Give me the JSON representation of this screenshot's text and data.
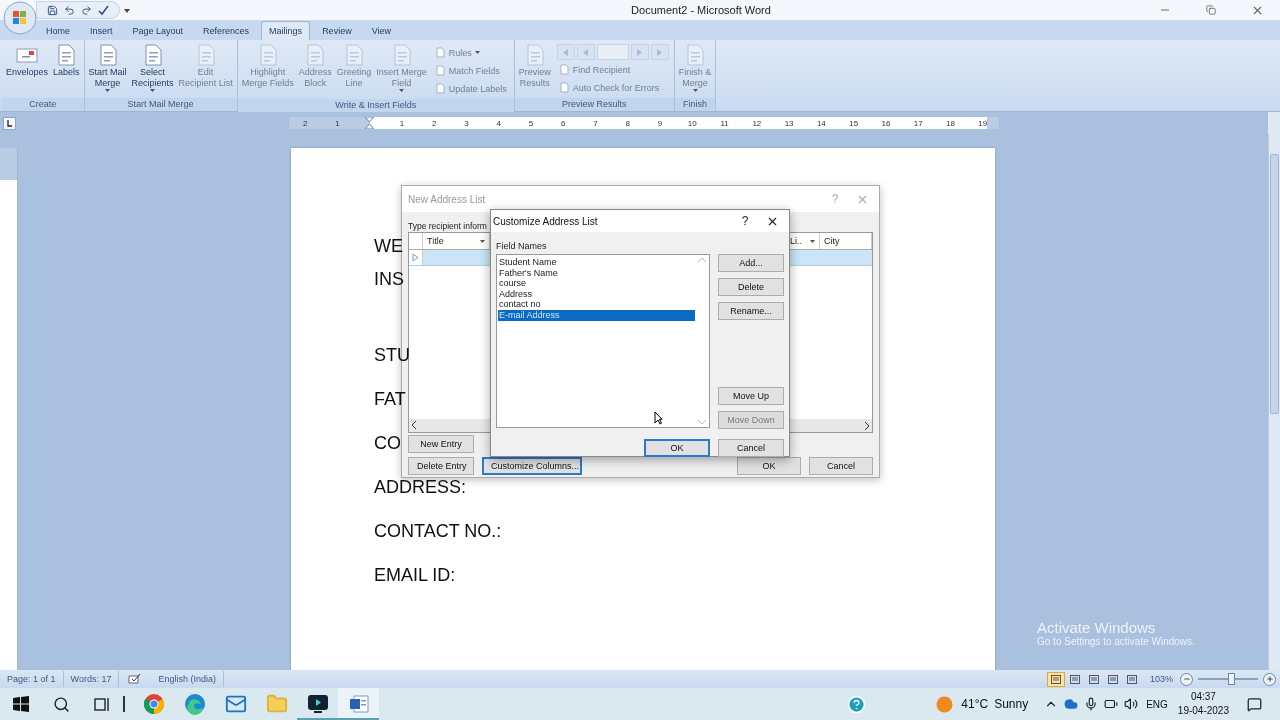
{
  "title_bar": {
    "title": "Document2 - Microsoft Word"
  },
  "tabs": [
    {
      "label": "Home",
      "selected": false
    },
    {
      "label": "Insert",
      "selected": false
    },
    {
      "label": "Page Layout",
      "selected": false
    },
    {
      "label": "References",
      "selected": false
    },
    {
      "label": "Mailings",
      "selected": true
    },
    {
      "label": "Review",
      "selected": false
    },
    {
      "label": "View",
      "selected": false
    }
  ],
  "ribbon_groups": [
    {
      "label": "Create",
      "items": [
        {
          "kind": "large",
          "label": "Envelopes",
          "dropdown": false,
          "disabled": false
        },
        {
          "kind": "large",
          "label": "Labels",
          "dropdown": false,
          "disabled": false
        }
      ]
    },
    {
      "label": "Start Mail Merge",
      "items": [
        {
          "kind": "large",
          "label": "Start Mail\nMerge",
          "dropdown": true,
          "disabled": false
        },
        {
          "kind": "large",
          "label": "Select\nRecipients",
          "dropdown": true,
          "disabled": false
        },
        {
          "kind": "large",
          "label": "Edit\nRecipient List",
          "dropdown": false,
          "disabled": true
        }
      ]
    },
    {
      "label": "Write & Insert Fields",
      "items": [
        {
          "kind": "large",
          "label": "Highlight\nMerge Fields",
          "dropdown": false,
          "disabled": true
        },
        {
          "kind": "large",
          "label": "Address\nBlock",
          "dropdown": false,
          "disabled": true
        },
        {
          "kind": "large",
          "label": "Greeting\nLine",
          "dropdown": false,
          "disabled": true
        },
        {
          "kind": "large",
          "label": "Insert Merge\nField",
          "dropdown": true,
          "disabled": true
        },
        {
          "kind": "small",
          "label": "Rules",
          "dropdown": true,
          "disabled": true
        },
        {
          "kind": "small",
          "label": "Match Fields",
          "dropdown": false,
          "disabled": true
        },
        {
          "kind": "small",
          "label": "Update Labels",
          "dropdown": false,
          "disabled": true
        }
      ]
    },
    {
      "label": "Preview Results",
      "items": [
        {
          "kind": "large",
          "label": "Preview\nResults",
          "dropdown": false,
          "disabled": true
        },
        {
          "kind": "nav",
          "disabled": true
        },
        {
          "kind": "small",
          "label": "Find Recipient",
          "dropdown": false,
          "disabled": true
        },
        {
          "kind": "small",
          "label": "Auto Check for Errors",
          "dropdown": false,
          "disabled": true
        }
      ]
    },
    {
      "label": "Finish",
      "items": [
        {
          "kind": "large",
          "label": "Finish &\nMerge",
          "dropdown": true,
          "disabled": true
        }
      ]
    }
  ],
  "ruler": {
    "marks": [
      "2",
      "1",
      "1",
      "2",
      "3",
      "4",
      "5",
      "6",
      "7",
      "8",
      "9",
      "10",
      "11",
      "12",
      "13",
      "14",
      "15",
      "16",
      "17",
      "18",
      "19"
    ]
  },
  "document": {
    "blocks": [
      [
        "WE",
        "INS"
      ],
      [
        "STU",
        "FAT",
        "CO",
        "ADDRESS:",
        "CONTACT NO.:",
        "EMAIL ID:"
      ]
    ]
  },
  "new_address_list": {
    "title": "New Address List",
    "help": "?",
    "instruction": "Type recipient inform",
    "columns": [
      {
        "label": "Title"
      },
      {
        "label": "Li.."
      },
      {
        "label": "City"
      }
    ],
    "buttons": [
      {
        "label": "New Entry",
        "focused": false
      },
      {
        "label": "Delete Entry",
        "focused": false
      },
      {
        "label": "Customize Columns...",
        "focused": true
      },
      {
        "label": "OK",
        "focused": false
      },
      {
        "label": "Cancel",
        "focused": false
      }
    ]
  },
  "customize_dialog": {
    "title": "Customize Address List",
    "help": "?",
    "list_label": "Field Names",
    "fields": [
      {
        "label": "Student Name",
        "selected": false
      },
      {
        "label": "Father's Name",
        "selected": false
      },
      {
        "label": "course",
        "selected": false
      },
      {
        "label": "Address",
        "selected": false
      },
      {
        "label": "contact no",
        "selected": false
      },
      {
        "label": "E-mail Address",
        "selected": true
      }
    ],
    "side_buttons": [
      {
        "label": "Add...",
        "disabled": false
      },
      {
        "label": "Delete",
        "disabled": false
      },
      {
        "label": "Rename...",
        "disabled": false
      },
      {
        "label": "Move Up",
        "disabled": false
      },
      {
        "label": "Move Down",
        "disabled": true
      }
    ],
    "ok": "OK",
    "cancel": "Cancel"
  },
  "status_bar": {
    "page": "Page: 1 of 1",
    "words": "Words: 17",
    "language": "English (India)",
    "views": [
      {
        "selected": true
      },
      {
        "selected": false
      },
      {
        "selected": false
      },
      {
        "selected": false
      },
      {
        "selected": false
      }
    ],
    "zoom": "103%",
    "zoom_slider": {
      "level": 0.55
    }
  },
  "activation_notice": {
    "title": "Activate Windows",
    "subtitle": "Go to Settings to activate Windows."
  },
  "taskbar": {
    "apps": [
      {
        "kind": "chrome",
        "open": false,
        "selected": false
      },
      {
        "kind": "edge",
        "open": false,
        "selected": false
      },
      {
        "kind": "mail",
        "open": false,
        "selected": false
      },
      {
        "kind": "explorer",
        "open": false,
        "selected": false
      },
      {
        "kind": "recorder",
        "open": true,
        "selected": false
      },
      {
        "kind": "word",
        "open": true,
        "selected": true
      }
    ],
    "temperature": "41°C",
    "condition": "Sunny",
    "language": "ENG",
    "time": "04:37",
    "date": "19-04-2023"
  }
}
